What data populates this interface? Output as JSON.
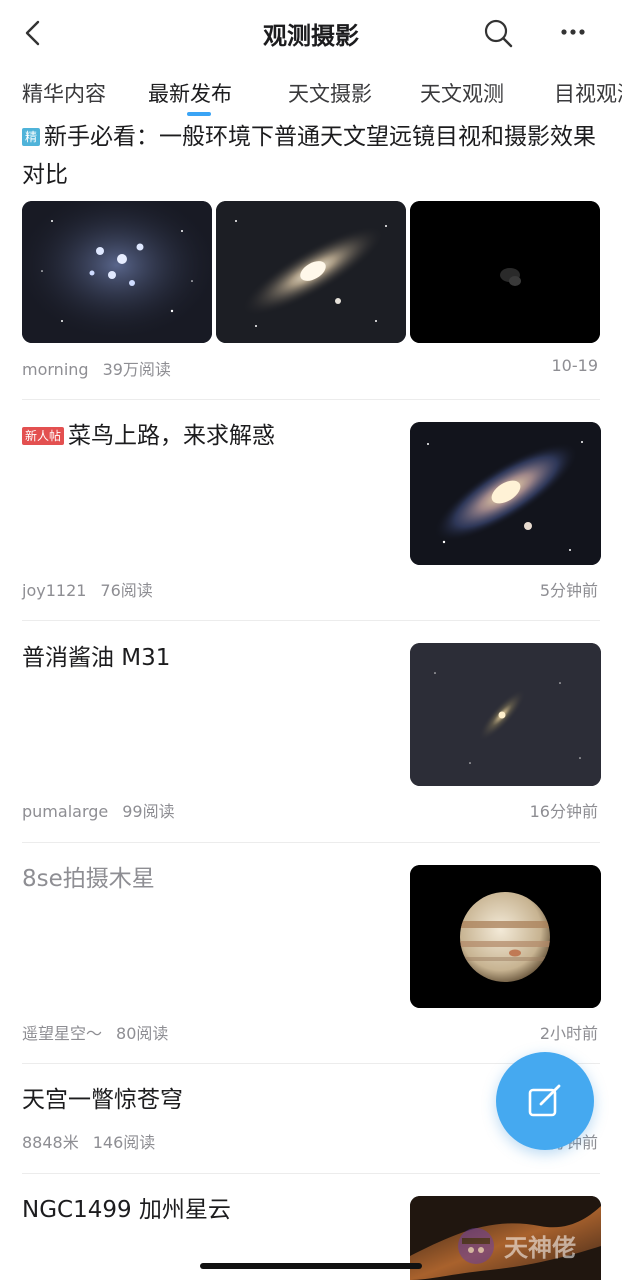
{
  "header": {
    "title": "观测摄影",
    "icons": [
      "back-icon",
      "search-icon",
      "more-icon"
    ]
  },
  "tabs": [
    {
      "label": "精华内容",
      "active": false
    },
    {
      "label": "最新发布",
      "active": true
    },
    {
      "label": "天文摄影",
      "active": false
    },
    {
      "label": "天文观测",
      "active": false
    },
    {
      "label": "目视观测",
      "active": false
    }
  ],
  "posts": [
    {
      "badge": "精",
      "title": "新手必看：一般环境下普通天文望远镜目视和摄影效果对比",
      "author": "morning",
      "reads": "39万阅读",
      "time": "10-19",
      "images": [
        "pleiades-cluster",
        "andromeda-galaxy",
        "faint-nebula"
      ]
    },
    {
      "badge": "新人帖",
      "title": "菜鸟上路，来求解惑",
      "author": "joy1121",
      "reads": "76阅读",
      "time": "5分钟前",
      "images": [
        "andromeda-galaxy"
      ]
    },
    {
      "title": "普消酱油 M31",
      "author": "pumalarge",
      "reads": "99阅读",
      "time": "16分钟前",
      "images": [
        "andromeda-galaxy-faint"
      ]
    },
    {
      "title": "8se拍摄木星",
      "author": "遥望星空～",
      "reads": "80阅读",
      "time": "2小时前",
      "images": [
        "jupiter"
      ]
    },
    {
      "title": "天宫一瞥惊苍穹",
      "author": "8848米",
      "reads": "146阅读",
      "time": "5分钟前"
    },
    {
      "title": "NGC1499 加州星云",
      "images": [
        "california-nebula"
      ]
    }
  ],
  "fab": {
    "icon": "compose-icon"
  },
  "watermark": {
    "text": "天神佬",
    "icon": "mascot-logo"
  },
  "colors": {
    "accent": "#3aa4f5",
    "fab": "#45a9f0",
    "badge_jing": "#4fb3d9",
    "badge_new": "#e35050"
  }
}
